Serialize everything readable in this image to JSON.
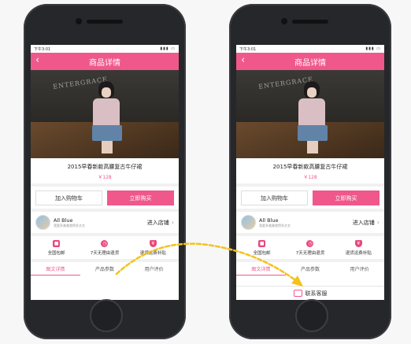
{
  "status_time": "下午3:01",
  "nav_title": "商品详情",
  "back_icon": "chevron-left-icon",
  "photo_text": "ENTERGRACE",
  "product": {
    "title": "2015早春新款高腰复古牛仔裙",
    "price": "￥128"
  },
  "buttons": {
    "cart": "加入购物车",
    "buy": "立即购买"
  },
  "shop": {
    "name": "All Blue",
    "desc": "我要多美美就得多文艺",
    "enter": "进入店铺"
  },
  "services": [
    {
      "icon": "package-icon",
      "label": "全国包邮"
    },
    {
      "icon": "clock-icon",
      "label": "7天无理由退货"
    },
    {
      "icon": "shield-icon",
      "label": "退货运费补贴"
    }
  ],
  "tabs": [
    "图文详情",
    "产品参数",
    "用户评价"
  ],
  "contact_label": "联系客服",
  "colors": {
    "accent": "#f0588c",
    "arrow": "#f4c21a"
  }
}
